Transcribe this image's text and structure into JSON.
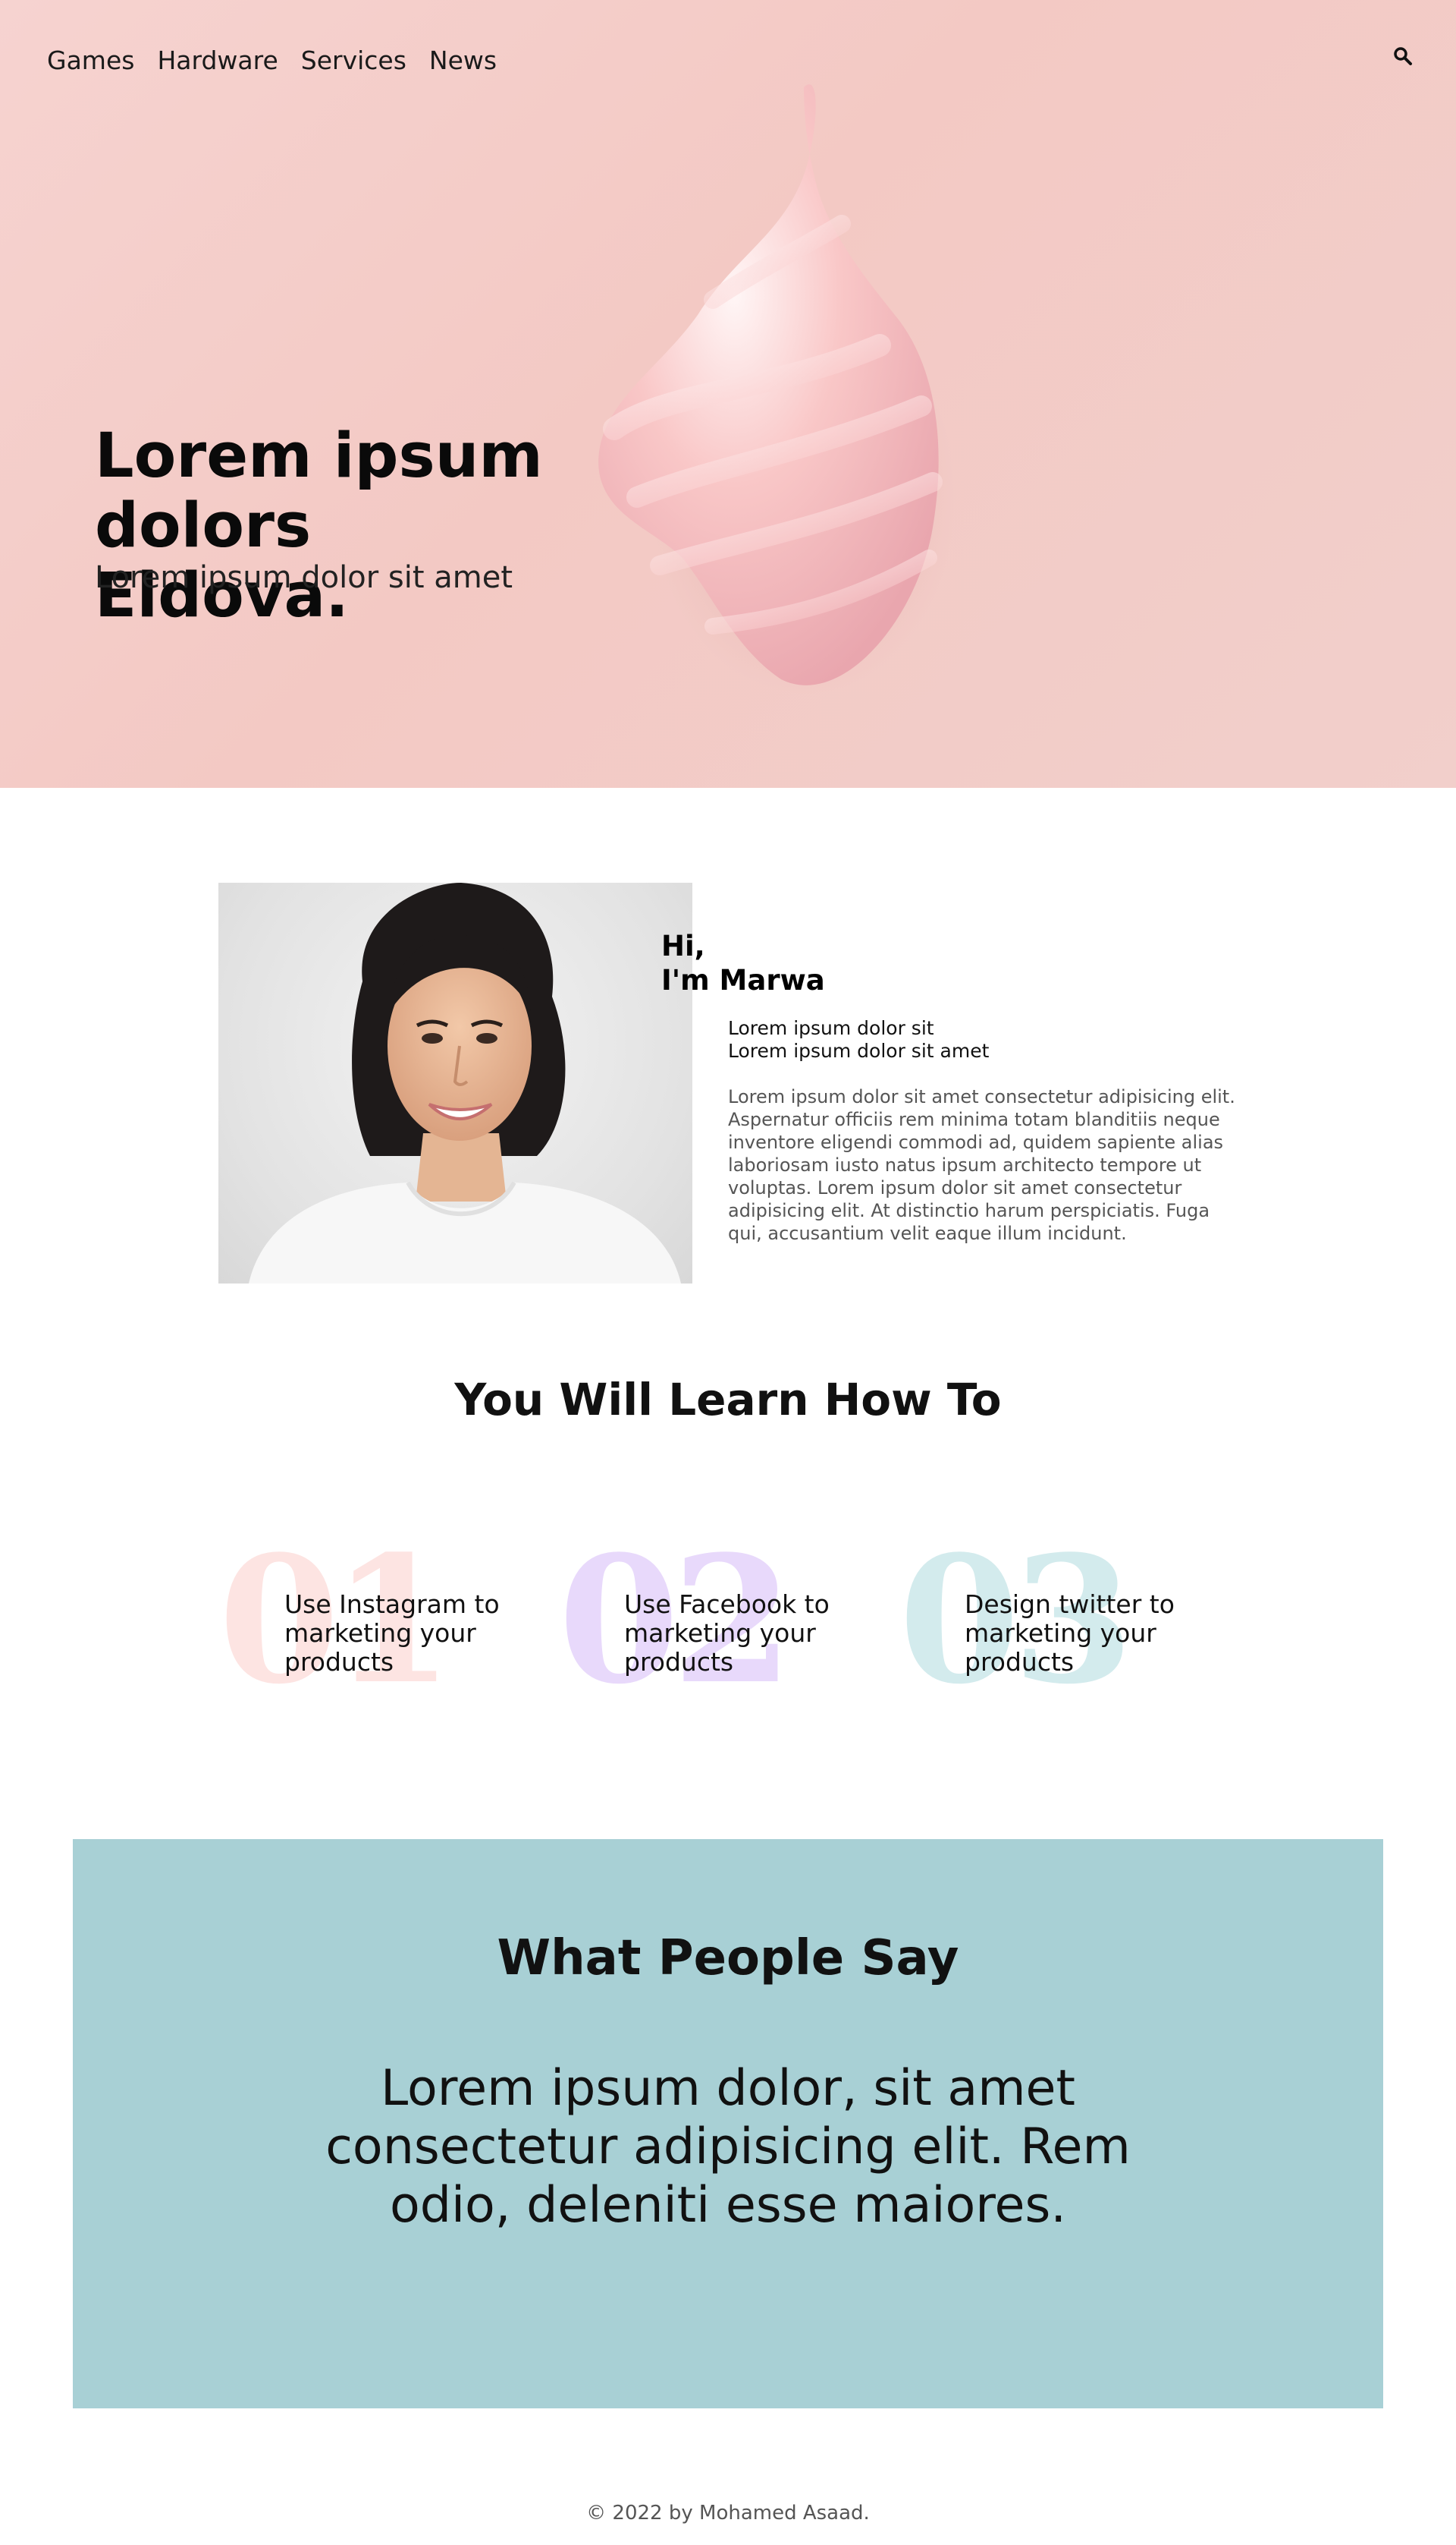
{
  "nav": {
    "items": [
      {
        "label": "Games"
      },
      {
        "label": "Hardware"
      },
      {
        "label": "Services"
      },
      {
        "label": "News"
      }
    ],
    "search_icon": "search-icon"
  },
  "hero": {
    "title_line1": "Lorem ipsum dolors",
    "title_line2": "Eldova.",
    "subtitle": "Lorem ipsum dolor sit amet"
  },
  "about": {
    "greeting_line1": "Hi,",
    "greeting_line2": "I'm Marwa",
    "tagline_line1": "Lorem ipsum dolor sit",
    "tagline_line2": "Lorem ipsum dolor sit amet",
    "bio": "Lorem ipsum dolor sit amet consectetur adipisicing elit. Aspernatur officiis rem minima totam blanditiis neque inventore eligendi commodi ad, quidem sapiente alias laboriosam iusto natus ipsum architecto tempore ut voluptas. Lorem ipsum dolor sit amet consectetur adipisicing elit. At distinctio harum perspiciatis. Fuga qui, accusantium velit eaque illum incidunt."
  },
  "learn": {
    "title": "You Will Learn How To",
    "steps": [
      {
        "number": "01",
        "text": "Use Instagram to marketing your products",
        "color": "#fde4e2"
      },
      {
        "number": "02",
        "text": "Use Facebook to marketing your products",
        "color": "#e8d9fb"
      },
      {
        "number": "03",
        "text": "Design twitter to marketing your products",
        "color": "#d3ebed"
      }
    ]
  },
  "testimonial": {
    "title": "What People Say",
    "quote": "Lorem ipsum dolor, sit amet consectetur adipisicing elit. Rem odio, deleniti esse maiores.",
    "background": "#a8d0d5"
  },
  "footer": {
    "text": "© 2022 by Mohamed Asaad."
  },
  "colors": {
    "hero_bg": "#f3c9c4",
    "text": "#111111"
  }
}
